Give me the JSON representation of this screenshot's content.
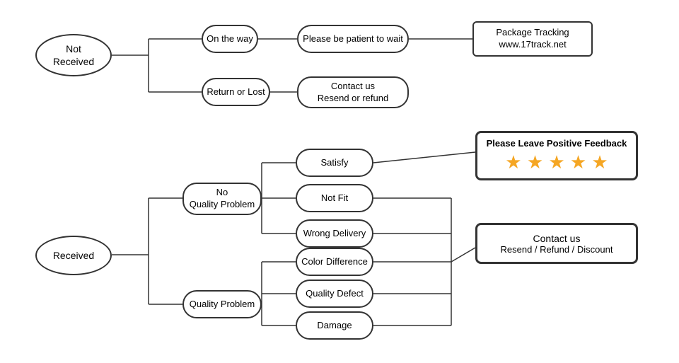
{
  "nodes": {
    "not_received": {
      "label": "Not\nReceived"
    },
    "on_the_way": {
      "label": "On the way"
    },
    "return_or_lost": {
      "label": "Return or Lost"
    },
    "patient": {
      "label": "Please be patient to wait"
    },
    "contact_resend": {
      "label": "Contact us\nResend or refund"
    },
    "package_tracking": {
      "label": "Package Tracking\nwww.17track.net"
    },
    "received": {
      "label": "Received"
    },
    "no_quality_problem": {
      "label": "No\nQuality Problem"
    },
    "quality_problem": {
      "label": "Quality Problem"
    },
    "satisfy": {
      "label": "Satisfy"
    },
    "not_fit": {
      "label": "Not Fit"
    },
    "wrong_delivery": {
      "label": "Wrong Delivery"
    },
    "color_difference": {
      "label": "Color Difference"
    },
    "quality_defect": {
      "label": "Quality Defect"
    },
    "damage": {
      "label": "Damage"
    },
    "feedback_title": {
      "label": "Please Leave Positive Feedback"
    },
    "feedback_stars": {
      "label": "★ ★ ★ ★ ★"
    },
    "contact_resend2_line1": {
      "label": "Contact us"
    },
    "contact_resend2_line2": {
      "label": "Resend / Refund / Discount"
    }
  }
}
